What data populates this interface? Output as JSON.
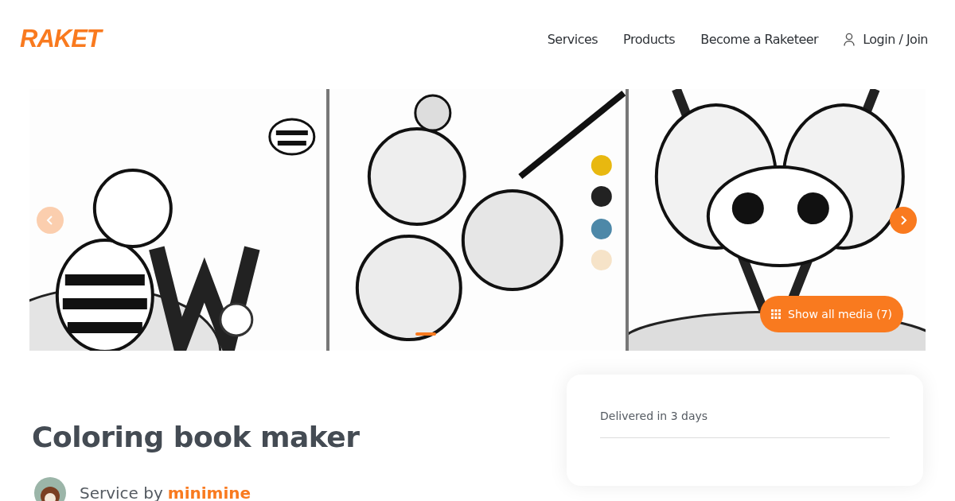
{
  "header": {
    "logo": "RAKET",
    "nav": [
      "Services",
      "Products",
      "Become a Raketeer"
    ],
    "login": "Login / Join"
  },
  "gallery": {
    "show_all": "Show all media (7)"
  },
  "service": {
    "title": "Coloring book maker",
    "by_label": "Service by",
    "seller": "minimine"
  },
  "order_card": {
    "delivery": "Delivered in 3 days"
  }
}
